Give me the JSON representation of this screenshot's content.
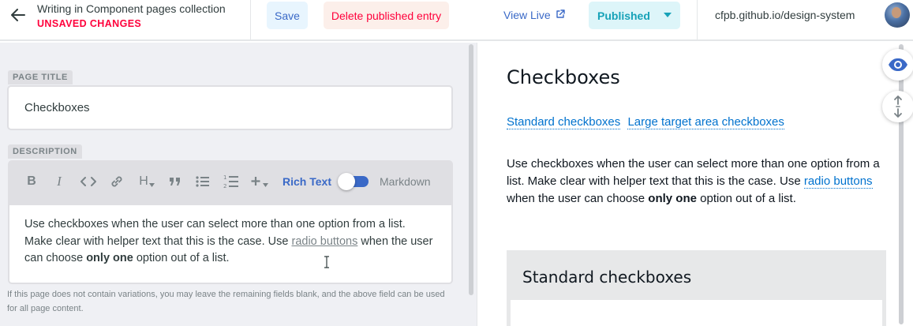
{
  "header": {
    "collection_title": "Writing in Component pages collection",
    "status_text": "UNSAVED CHANGES",
    "save_label": "Save",
    "delete_label": "Delete published entry",
    "view_live_label": "View Live",
    "publish_status": "Published",
    "site_url": "cfpb.github.io/design-system"
  },
  "editor": {
    "page_title_label": "PAGE TITLE",
    "page_title_value": "Checkboxes",
    "description_label": "DESCRIPTION",
    "toolbar": {
      "icons": [
        "bold-icon",
        "italic-icon",
        "code-icon",
        "link-icon",
        "heading-icon",
        "quote-icon",
        "bulleted-list-icon",
        "numbered-list-icon",
        "add-component-icon"
      ],
      "heading_glyph": "H",
      "bold_glyph": "B",
      "italic_glyph": "I",
      "rich_text_label": "Rich Text",
      "markdown_label": "Markdown",
      "mode": "Rich Text"
    },
    "description": {
      "part1": "Use checkboxes when the user can select more than one option from a list. Make clear with helper text that this is the case. Use ",
      "link": "radio buttons",
      "part2": " when the user can choose ",
      "bold": "only one",
      "part3": " option out of a list."
    },
    "hint": "If this page does not contain variations, you may leave the remaining fields blank, and the above field can be used for all page content."
  },
  "preview": {
    "title": "Checkboxes",
    "links": [
      "Standard checkboxes",
      "Large target area checkboxes"
    ],
    "description": {
      "part1": "Use checkboxes when the user can select more than one option from a list. Make clear with helper text that this is the case. Use ",
      "link": "radio buttons",
      "part2": " when the user can choose ",
      "bold": "only one",
      "part3": " option out of a list."
    },
    "section_title": "Standard checkboxes",
    "fab_icons": [
      "eye-icon",
      "sync-scroll-icon"
    ]
  },
  "colors": {
    "accent": "#3a69c7",
    "danger": "#ff003b",
    "published": "#17a2b8",
    "link": "#0072ce"
  }
}
